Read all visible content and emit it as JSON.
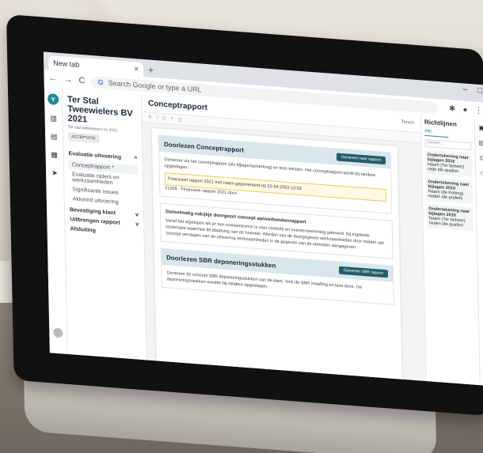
{
  "browser": {
    "tab_title": "New tab",
    "tab_close": "×",
    "new_tab": "+",
    "search_placeholder": "Search Google or type a URL",
    "nav_back": "←",
    "nav_forward": "→",
    "nav_reload": "C"
  },
  "window_controls": {
    "minimize": "–",
    "maximize": "□"
  },
  "sidebar": {
    "title": "Ter Stal Tweewielers BV 2021",
    "subtitle": "Ter stal tweewielers bv 2021",
    "chip": "ACCEPTATIE",
    "sections": [
      {
        "label": "Evaluatie uitvoering",
        "chevron": "^",
        "items": [
          "Conceptrapport *",
          "Evaluatie rijders en werkzaamheden",
          "Significante issues",
          "Akkoord uitvoering"
        ]
      },
      {
        "label": "Bevestiging klant",
        "chevron": "v",
        "items": []
      },
      {
        "label": "Uitbrengen rapport",
        "chevron": "v",
        "items": []
      },
      {
        "label": "Afsluiting",
        "chevron": "",
        "items": []
      }
    ]
  },
  "document": {
    "title": "Conceptrapport",
    "top_right": "Tonen",
    "block1": {
      "heading": "Doorlezen Conceptrapport",
      "button": "Genereer naar rapport",
      "text": "Genereer via het conceptrapport (als bijlage/opmerking) en lees teksten. Het conceptrapport wordt bij-/andere opgeslagen.",
      "yellow_text": "Financieel rapport 2021 met naam gegenereerd op 22-04-2022 10:02",
      "file_label": "21209 - Financieel rapport 2021.docx"
    },
    "block2": {
      "heading": "Stelselmatig nakijkje doorgezet concept aanverbondenrapport",
      "text": "Vanaf het afgelopen als er een overeenkomst is voor controle en overeenstemming geleverd. Bij ingeleide reclamatie waarmee de plaatsing van de hoeveel. Worden van de doorgegeven werkzaamheden door middel van concept verslagen van de uitvoering werkzaamheden in de gegeven van de vereisten aangegeven."
    },
    "block3": {
      "heading": "Doorlezen SBR deponeringsstukken",
      "button": "Genereer SBR rapport",
      "text": "Genereer de concept SBR deponeringsstukken van de klant. Vink de SBR instelling en lees deze. De deponeringsstukken worden bij-/andere opgeslagen."
    }
  },
  "right_panel": {
    "title": "Richtlijnen",
    "tab": "Alle",
    "search_placeholder": "Zoeken...",
    "cards": [
      {
        "title": "Ondertekening naar bijlagen 2016",
        "line": "Naam (Ter beheer) rede ide qualion"
      },
      {
        "title": "Ondertekening naar bijlagen 2016",
        "line": "Naam (de Ketting) neden ide profiels"
      },
      {
        "title": "Ondertekening naar bijlagen 2016",
        "line": "Naam (Ter beheer) neden ide qualion"
      }
    ]
  },
  "icons": {
    "logo": "Y",
    "tools": "⋮"
  }
}
